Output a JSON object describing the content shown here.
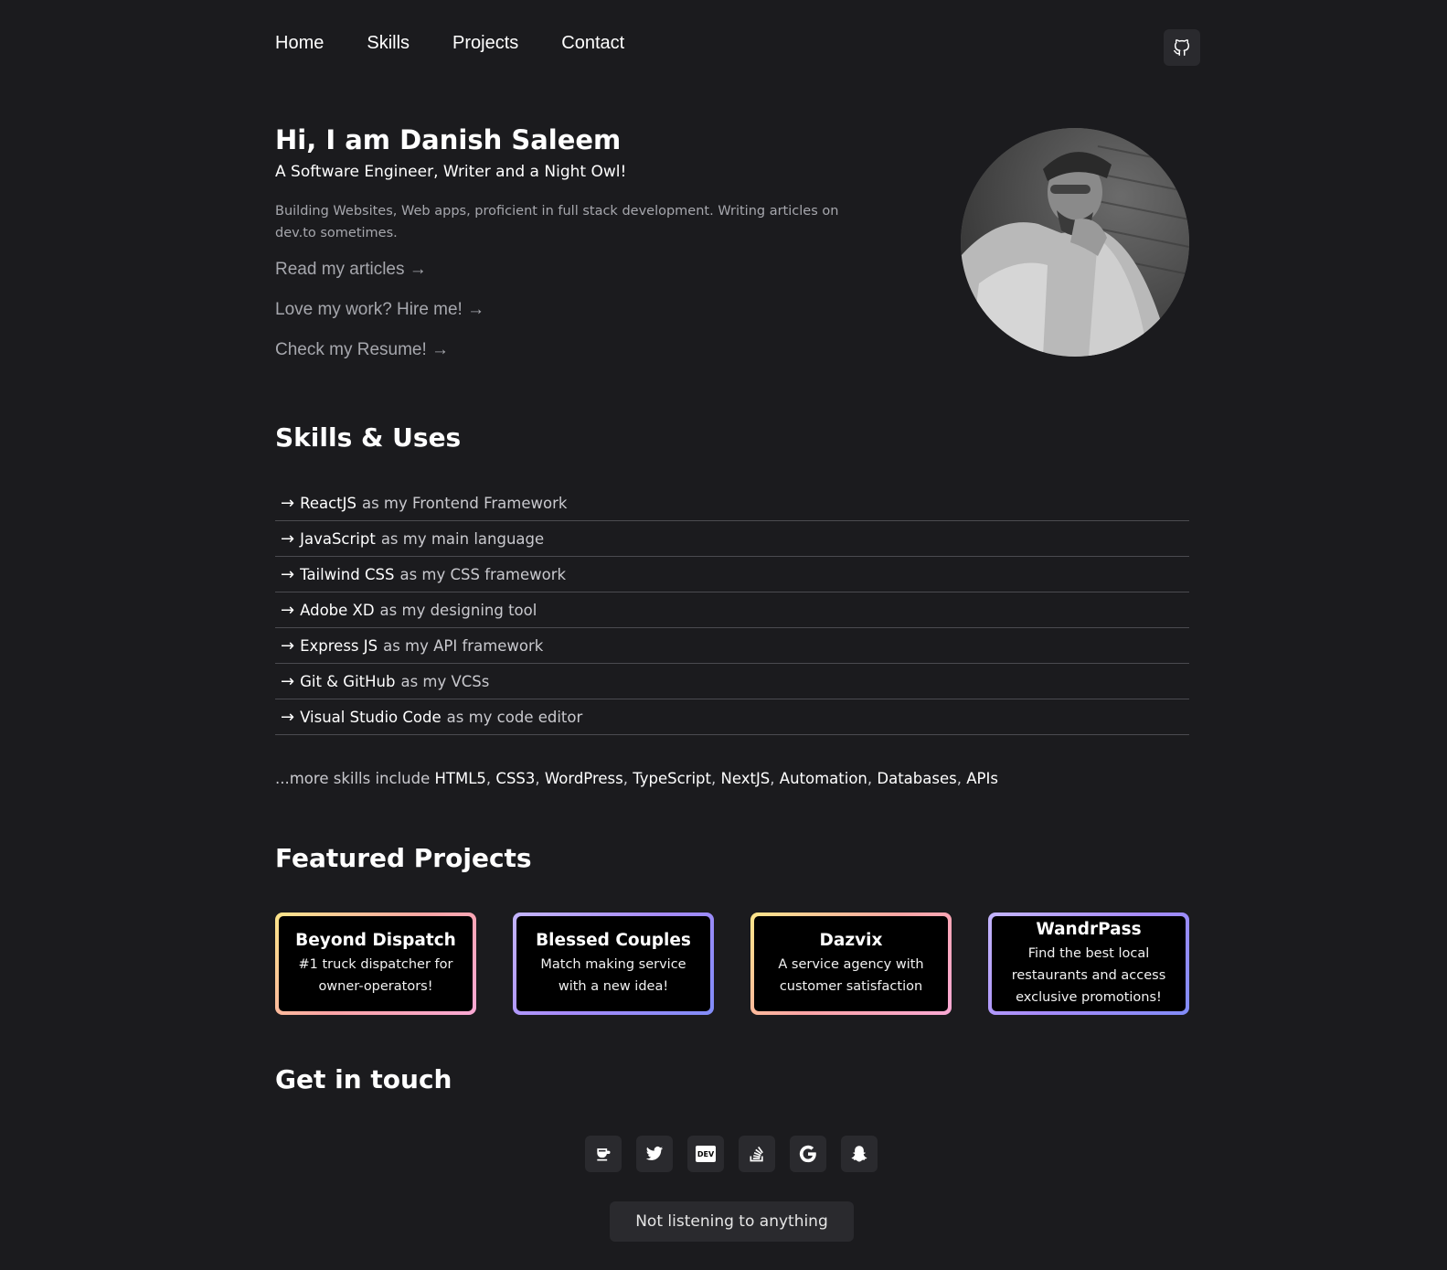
{
  "nav": {
    "items": [
      "Home",
      "Skills",
      "Projects",
      "Contact"
    ],
    "github_icon": "github-icon"
  },
  "hero": {
    "title": "Hi, I am Danish Saleem",
    "subtitle": "A Software Engineer, Writer and a Night Owl!",
    "description": "Building Websites, Web apps, proficient in full stack development. Writing articles on dev.to sometimes.",
    "links": [
      "Read my articles →",
      "Love my work? Hire me! →",
      "Check my Resume! →"
    ]
  },
  "skills": {
    "heading": "Skills & Uses",
    "items": [
      {
        "name": "ReactJS",
        "rest": "as my Frontend Framework"
      },
      {
        "name": "JavaScript",
        "rest": "as my main language"
      },
      {
        "name": "Tailwind CSS",
        "rest": "as my CSS framework"
      },
      {
        "name": "Adobe XD",
        "rest": "as my designing tool"
      },
      {
        "name": "Express JS",
        "rest": "as my API framework"
      },
      {
        "name": "Git & GitHub",
        "rest": "as my VCSs"
      },
      {
        "name": "Visual Studio Code",
        "rest": "as my code editor"
      }
    ],
    "more_prefix": "...more skills include",
    "more_items": [
      "HTML5",
      "CSS3",
      "WordPress",
      "TypeScript",
      "NextJS",
      "Automation",
      "Databases",
      "APIs"
    ]
  },
  "projects": {
    "heading": "Featured Projects",
    "cards": [
      {
        "title": "Beyond Dispatch",
        "desc": "#1 truck dispatcher for owner-operators!"
      },
      {
        "title": "Blessed Couples",
        "desc": "Match making service with a new idea!"
      },
      {
        "title": "Dazvix",
        "desc": "A service agency with customer satisfaction"
      },
      {
        "title": "WandrPass",
        "desc": "Find the best local restaurants and access exclusive promotions!"
      }
    ]
  },
  "contact": {
    "heading": "Get in touch",
    "icons": [
      "coffee-icon",
      "twitter-icon",
      "dev-icon",
      "stackoverflow-icon",
      "google-icon",
      "snapchat-icon"
    ],
    "dev_label": "DEV"
  },
  "spotify": {
    "status": "Not listening to anything"
  }
}
